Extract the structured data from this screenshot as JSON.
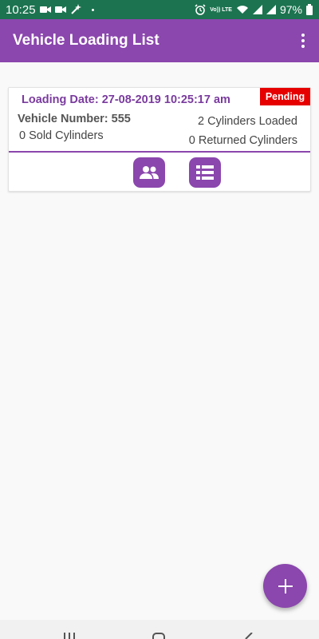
{
  "status_bar": {
    "time": "10:25",
    "battery": "97%",
    "network_label": "Vo)) LTE",
    "icons": [
      "video-icon",
      "video-icon",
      "magic-wand-icon",
      "alarm-icon",
      "wifi-icon",
      "signal-icon",
      "signal-icon",
      "battery-icon"
    ]
  },
  "app_bar": {
    "title": "Vehicle Loading List",
    "menu_icon": "more-vert-icon"
  },
  "loading_list": [
    {
      "loading_date": "Loading Date: 27-08-2019 10:25:17 am",
      "status": "Pending",
      "vehicle_number": "Vehicle Number: 555",
      "sold": "0 Sold Cylinders",
      "loaded": "2 Cylinders Loaded",
      "returned": "0 Returned Cylinders",
      "actions": [
        "people-icon",
        "list-icon"
      ]
    }
  ],
  "fab": {
    "label": "+",
    "icon": "add-icon"
  },
  "nav_bar": {
    "icons": [
      "recents-icon",
      "home-icon",
      "back-icon"
    ]
  },
  "colors": {
    "status_bar": "#1c7350",
    "primary": "#8b47ad",
    "date_text": "#7a3b9e",
    "badge": "#e60000",
    "background": "#f9f9f9"
  }
}
